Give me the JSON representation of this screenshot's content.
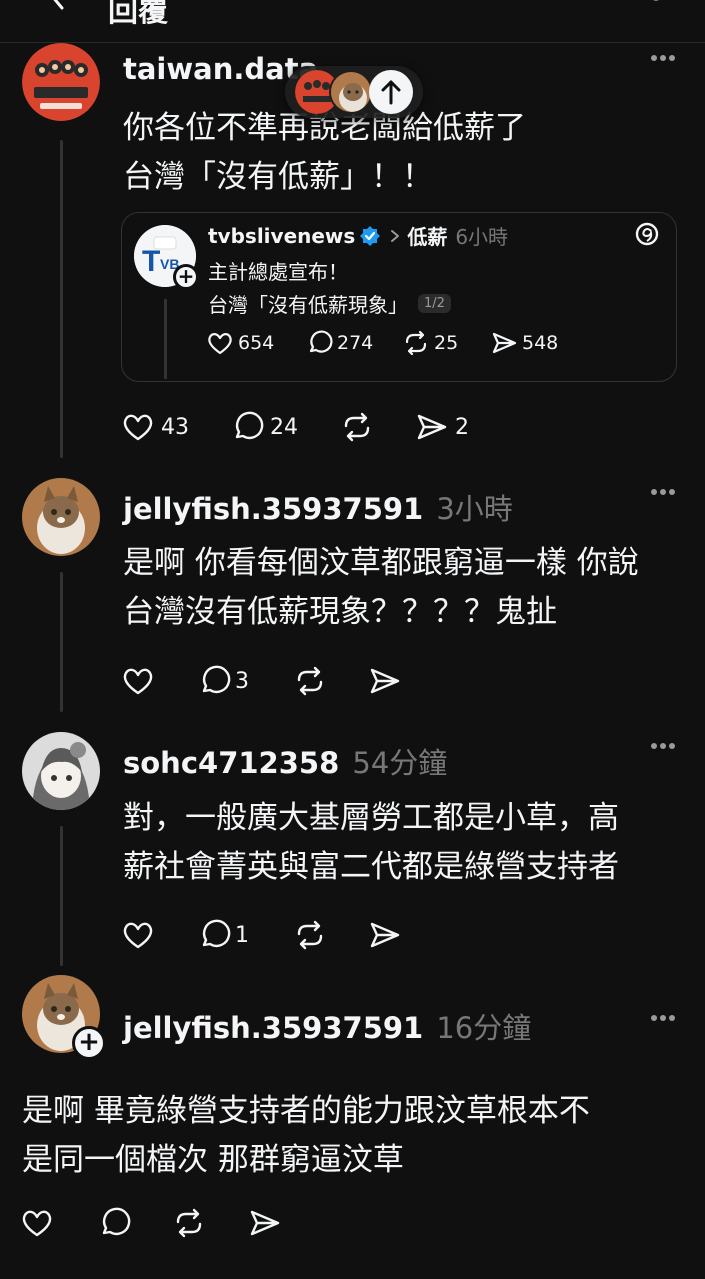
{
  "header": {
    "title": "回覆"
  },
  "pill": {
    "icon": "arrow-up-icon"
  },
  "posts": [
    {
      "username": "taiwan.data",
      "lines": [
        "你各位不準再說老闆給低薪了",
        "台灣「沒有低薪」！！"
      ],
      "quote": {
        "username": "tvbslivenews",
        "topic": "低薪",
        "time": "6小時",
        "line1": "主計總處宣布！",
        "line2": "台灣「沒有低薪現象」",
        "page": "1/2",
        "likes": "654",
        "replies": "274",
        "reposts": "25",
        "shares": "548"
      },
      "likes": "43",
      "replies": "24",
      "shares": "2"
    },
    {
      "username": "jellyfish.35937591",
      "time": "3小時",
      "lines": [
        "是啊 你看每個汶草都跟窮逼一樣 你說",
        "台灣沒有低薪現象？？？？鬼扯"
      ],
      "replies": "3"
    },
    {
      "username": "sohc4712358",
      "time": "54分鐘",
      "lines": [
        "對，一般廣大基層勞工都是小草，高",
        "薪社會菁英與富二代都是綠營支持者"
      ],
      "replies": "1"
    },
    {
      "username": "jellyfish.35937591",
      "time": "16分鐘",
      "lines": [
        "是啊 畢竟綠營支持者的能力跟汶草根本不",
        "是同一個檔次 那群窮逼汶草"
      ]
    }
  ],
  "colors": {
    "background": "#101010",
    "text": "#f3f5f7",
    "muted": "#777777",
    "avatar_red": "#d9442e",
    "verified": "#1d9bf0"
  }
}
